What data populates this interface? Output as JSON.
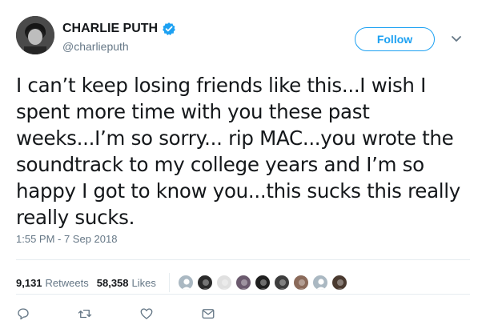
{
  "header": {
    "display_name": "CHARLIE PUTH",
    "handle": "@charlieputh",
    "follow_label": "Follow",
    "verified": true
  },
  "tweet": {
    "text": "I can’t keep losing friends like this...I wish I spent more time with you these past weeks...I’m so sorry... rip MAC...you wrote the soundtrack to my college years and I’m so happy I got to know you...this sucks this really really sucks.",
    "timestamp": "1:55 PM - 7 Sep 2018"
  },
  "stats": {
    "retweets_count": "9,131",
    "retweets_label": "Retweets",
    "likes_count": "58,358",
    "likes_label": "Likes"
  },
  "likers": [
    {
      "icon": "default-avatar-icon",
      "color": "#aab8c2"
    },
    {
      "icon": "user-avatar-icon",
      "color": "#2b2b2b"
    },
    {
      "icon": "user-avatar-icon",
      "color": "#e0e0e0"
    },
    {
      "icon": "user-avatar-icon",
      "color": "#6b5a6e"
    },
    {
      "icon": "user-avatar-icon",
      "color": "#1f1f1f"
    },
    {
      "icon": "user-avatar-icon",
      "color": "#3d3d3d"
    },
    {
      "icon": "user-avatar-icon",
      "color": "#8a6a5a"
    },
    {
      "icon": "default-avatar-icon",
      "color": "#aab8c2"
    },
    {
      "icon": "user-avatar-icon",
      "color": "#4a3a30"
    }
  ],
  "actions": [
    "reply-icon",
    "retweet-icon",
    "like-icon",
    "message-icon"
  ],
  "colors": {
    "accent": "#1da1f2",
    "text": "#14171a",
    "muted": "#657786",
    "border": "#e6ecf0"
  }
}
